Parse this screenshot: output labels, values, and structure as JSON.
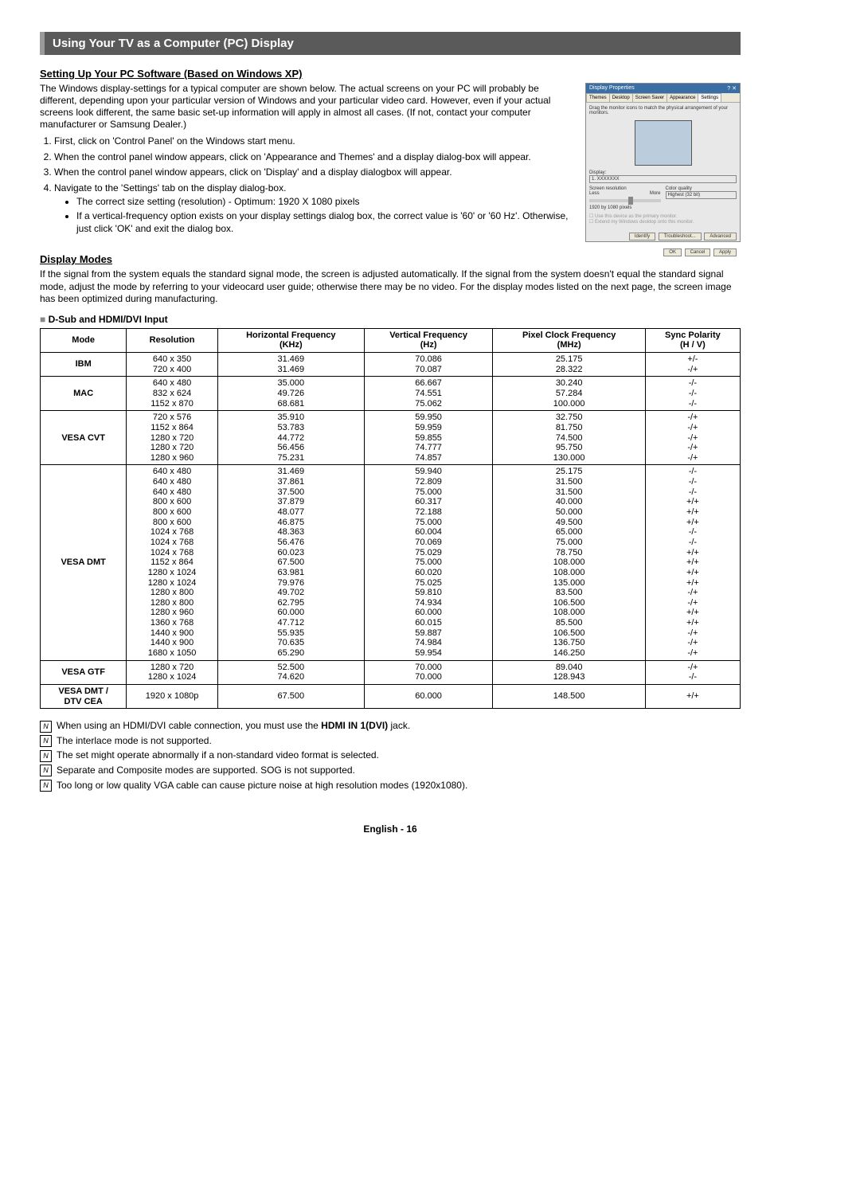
{
  "header": "Using Your TV as a Computer (PC) Display",
  "section1": {
    "heading": "Setting Up Your PC Software (Based on Windows XP)",
    "intro": "The Windows display-settings for a typical computer are shown below. The actual screens on your PC will probably be different, depending upon your particular version of Windows and your particular video card. However, even if your actual screens look different, the same basic set-up information will apply in almost all cases. (If not, contact your computer manufacturer or Samsung Dealer.)",
    "steps": [
      "First, click on 'Control Panel' on the Windows start menu.",
      "When the control panel window appears, click on 'Appearance and Themes' and a display dialog-box will appear.",
      "When the control panel window appears, click on 'Display' and a display dialogbox will appear.",
      "Navigate to the 'Settings' tab on the display dialog-box."
    ],
    "bullets": [
      "The correct size setting (resolution) - Optimum: 1920 X 1080 pixels",
      "If a vertical-frequency option exists on your display settings dialog box, the correct value is '60' or '60 Hz'. Otherwise, just click 'OK' and exit the dialog box."
    ]
  },
  "dialog": {
    "title": "Display Properties",
    "tabs": [
      "Themes",
      "Desktop",
      "Screen Saver",
      "Appearance",
      "Settings"
    ],
    "active_tab": "Settings",
    "hint": "Drag the monitor icons to match the physical arrangement of your monitors.",
    "display_label": "Display:",
    "display_value": "1. XXXXXXX",
    "res_label": "Screen resolution",
    "res_less": "Less",
    "res_more": "More",
    "res_value": "1920 by 1080 pixels",
    "cq_label": "Color quality",
    "cq_value": "Highest (32 bit)",
    "chk1": "Use this device as the primary monitor.",
    "chk2": "Extend my Windows desktop onto this monitor.",
    "btns_row1": [
      "Identify",
      "Troubleshoot...",
      "Advanced"
    ],
    "btns_row2": [
      "OK",
      "Cancel",
      "Apply"
    ]
  },
  "section2": {
    "heading": "Display Modes",
    "body": "If the signal from the system equals the standard signal mode, the screen is adjusted automatically. If the signal from the system doesn't equal the standard signal mode, adjust the mode by referring to your videocard user guide; otherwise there may be no video. For the display modes listed on the next page, the screen image has been optimized during manufacturing.",
    "table_caption": "D-Sub and HDMI/DVI Input",
    "columns": [
      "Mode",
      "Resolution",
      "Horizontal Frequency\n(KHz)",
      "Vertical Frequency\n(Hz)",
      "Pixel Clock Frequency\n(MHz)",
      "Sync Polarity\n(H / V)"
    ],
    "rows": [
      {
        "mode": "IBM",
        "res": "640 x 350\n720 x 400",
        "h": "31.469\n31.469",
        "v": "70.086\n70.087",
        "p": "25.175\n28.322",
        "s": "+/-\n-/+"
      },
      {
        "mode": "MAC",
        "res": "640 x 480\n832 x 624\n1152 x 870",
        "h": "35.000\n49.726\n68.681",
        "v": "66.667\n74.551\n75.062",
        "p": "30.240\n57.284\n100.000",
        "s": "-/-\n-/-\n-/-"
      },
      {
        "mode": "VESA CVT",
        "res": "720 x 576\n1152 x 864\n1280 x 720\n1280 x 720\n1280 x 960",
        "h": "35.910\n53.783\n44.772\n56.456\n75.231",
        "v": "59.950\n59.959\n59.855\n74.777\n74.857",
        "p": "32.750\n81.750\n74.500\n95.750\n130.000",
        "s": "-/+\n-/+\n-/+\n-/+\n-/+"
      },
      {
        "mode": "VESA DMT",
        "res": "640 x 480\n640 x 480\n640 x 480\n800 x 600\n800 x 600\n800 x 600\n1024 x 768\n1024 x 768\n1024 x 768\n1152 x 864\n1280 x 1024\n1280 x 1024\n1280 x 800\n1280 x 800\n1280 x 960\n1360 x 768\n1440 x 900\n1440 x 900\n1680 x 1050",
        "h": "31.469\n37.861\n37.500\n37.879\n48.077\n46.875\n48.363\n56.476\n60.023\n67.500\n63.981\n79.976\n49.702\n62.795\n60.000\n47.712\n55.935\n70.635\n65.290",
        "v": "59.940\n72.809\n75.000\n60.317\n72.188\n75.000\n60.004\n70.069\n75.029\n75.000\n60.020\n75.025\n59.810\n74.934\n60.000\n60.015\n59.887\n74.984\n59.954",
        "p": "25.175\n31.500\n31.500\n40.000\n50.000\n49.500\n65.000\n75.000\n78.750\n108.000\n108.000\n135.000\n83.500\n106.500\n108.000\n85.500\n106.500\n136.750\n146.250",
        "s": "-/-\n-/-\n-/-\n+/+\n+/+\n+/+\n-/-\n-/-\n+/+\n+/+\n+/+\n+/+\n-/+\n-/+\n+/+\n+/+\n-/+\n-/+\n-/+"
      },
      {
        "mode": "VESA GTF",
        "res": "1280 x 720\n1280 x 1024",
        "h": "52.500\n74.620",
        "v": "70.000\n70.000",
        "p": "89.040\n128.943",
        "s": "-/+\n-/-"
      },
      {
        "mode": "VESA DMT /\nDTV CEA",
        "res": "1920 x 1080p",
        "h": "67.500",
        "v": "60.000",
        "p": "148.500",
        "s": "+/+"
      }
    ]
  },
  "notes": [
    {
      "pre": "When using an HDMI/DVI cable connection, you must use the ",
      "bold": "HDMI IN 1(DVI)",
      "post": " jack."
    },
    {
      "pre": "The interlace mode is not supported.",
      "bold": "",
      "post": ""
    },
    {
      "pre": "The set might operate abnormally if a non-standard video format is selected.",
      "bold": "",
      "post": ""
    },
    {
      "pre": "Separate and Composite modes are supported. SOG is not supported.",
      "bold": "",
      "post": ""
    },
    {
      "pre": "Too long or low quality VGA cable can cause picture noise at high resolution modes (1920x1080).",
      "bold": "",
      "post": ""
    }
  ],
  "footer": "English - 16"
}
